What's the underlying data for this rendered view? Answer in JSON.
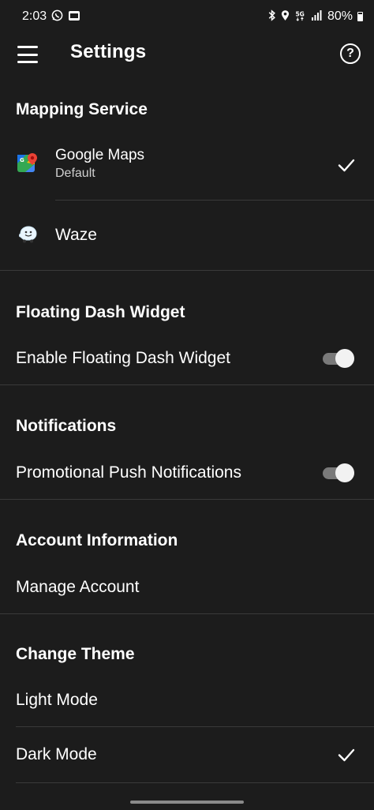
{
  "status_bar": {
    "time": "2:03",
    "battery": "80%"
  },
  "app_bar": {
    "title": "Settings"
  },
  "sections": {
    "mapping": {
      "header": "Mapping Service",
      "google_maps": {
        "label": "Google Maps",
        "sub": "Default",
        "selected": true
      },
      "waze": {
        "label": "Waze",
        "selected": false
      }
    },
    "floating": {
      "header": "Floating Dash Widget",
      "enable_label": "Enable Floating Dash Widget",
      "enabled": true
    },
    "notifications": {
      "header": "Notifications",
      "promo_label": "Promotional Push Notifications",
      "enabled": true
    },
    "account": {
      "header": "Account Information",
      "manage_label": "Manage Account"
    },
    "theme": {
      "header": "Change Theme",
      "light_label": "Light Mode",
      "dark_label": "Dark Mode",
      "selected": "dark"
    }
  },
  "colors": {
    "background": "#1c1c1c",
    "divider": "#3a3a3a",
    "toggle_track": "#7a7a7a",
    "toggle_thumb": "#f2f2f2"
  }
}
